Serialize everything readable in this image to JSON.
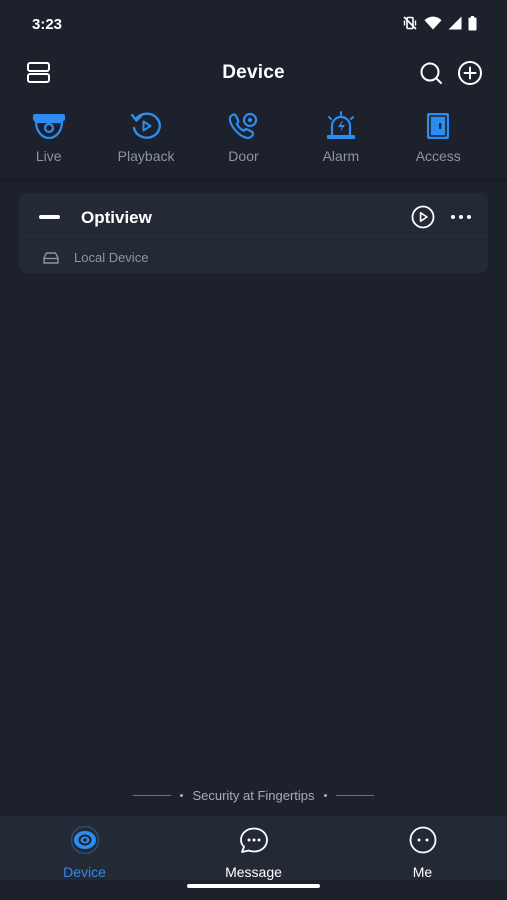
{
  "status_bar": {
    "time": "3:23",
    "icons": [
      "vibrate-off-icon",
      "wifi-icon",
      "signal-icon",
      "battery-icon"
    ]
  },
  "header": {
    "title": "Device",
    "left_icon": "device-list-icon",
    "right_icons": [
      "search-icon",
      "add-icon"
    ]
  },
  "quick_menu": [
    {
      "label": "Live",
      "icon": "camera-icon"
    },
    {
      "label": "Playback",
      "icon": "playback-icon"
    },
    {
      "label": "Door",
      "icon": "door-phone-icon"
    },
    {
      "label": "Alarm",
      "icon": "alarm-icon"
    },
    {
      "label": "Access",
      "icon": "access-icon"
    }
  ],
  "device_group": {
    "name": "Optiview",
    "actions": [
      "play-icon",
      "more-icon"
    ],
    "devices": [
      {
        "label": "Local Device",
        "icon": "local-device-icon"
      }
    ]
  },
  "slogan": "Security at Fingertips",
  "bottom_nav": [
    {
      "label": "Device",
      "icon": "device-tab-icon",
      "active": true
    },
    {
      "label": "Message",
      "icon": "message-tab-icon",
      "active": false
    },
    {
      "label": "Me",
      "icon": "me-tab-icon",
      "active": false
    }
  ],
  "colors": {
    "background": "#1c212b",
    "card": "#232a36",
    "accent": "#2d8cf0",
    "muted_text": "#8d95a3"
  }
}
